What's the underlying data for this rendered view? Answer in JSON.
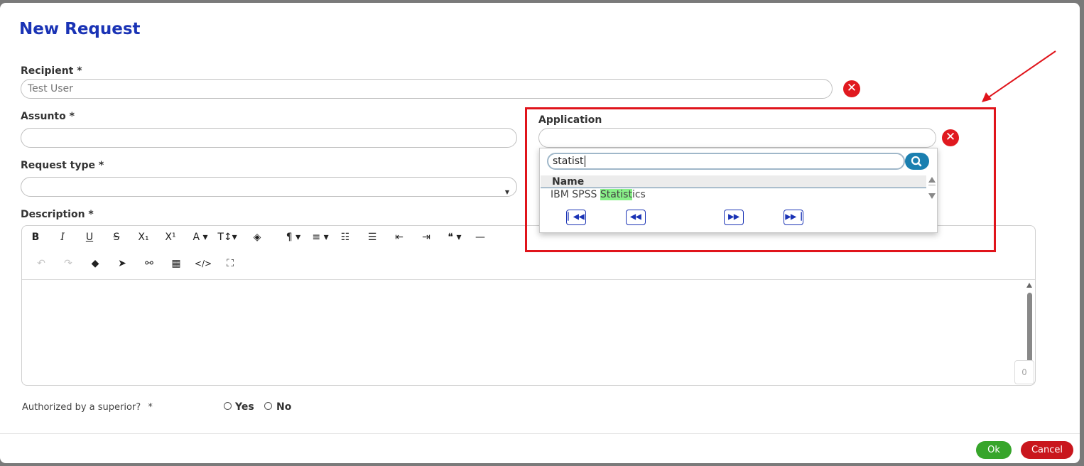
{
  "dialog": {
    "title": "New Request"
  },
  "recipient": {
    "label": "Recipient *",
    "value": "Test User"
  },
  "assunto": {
    "label": "Assunto *",
    "value": ""
  },
  "request_type": {
    "label": "Request type *",
    "value": ""
  },
  "description": {
    "label": "Description *",
    "toolbar_row1": [
      {
        "name": "bold-button",
        "glyph": "B"
      },
      {
        "name": "italic-button",
        "glyph": "I"
      },
      {
        "name": "underline-button",
        "glyph": "U"
      },
      {
        "name": "strikethrough-button",
        "glyph": "S"
      },
      {
        "name": "subscript-button",
        "glyph": "X₁"
      },
      {
        "name": "superscript-button",
        "glyph": "X¹"
      },
      {
        "name": "font-color-dropdown",
        "glyph": "A ▾"
      },
      {
        "name": "font-size-dropdown",
        "glyph": "T↕ ▾"
      },
      {
        "name": "paint-bucket-icon",
        "glyph": "⛽"
      },
      {
        "name": "paragraph-dropdown",
        "glyph": "¶ ▾"
      },
      {
        "name": "align-dropdown",
        "glyph": "≡ ▾"
      },
      {
        "name": "ordered-list-button",
        "glyph": "⒈"
      },
      {
        "name": "unordered-list-button",
        "glyph": "☰"
      },
      {
        "name": "outdent-button",
        "glyph": "⇤"
      },
      {
        "name": "indent-button",
        "glyph": "⇥"
      },
      {
        "name": "quote-dropdown",
        "glyph": "❝ ▾"
      },
      {
        "name": "horizontal-rule-button",
        "glyph": "—"
      }
    ],
    "toolbar_row2": [
      {
        "name": "undo-button",
        "glyph": "↶"
      },
      {
        "name": "redo-button",
        "glyph": "↷"
      },
      {
        "name": "eraser-button",
        "glyph": "⌫"
      },
      {
        "name": "select-cursor-button",
        "glyph": "➤"
      },
      {
        "name": "link-button",
        "glyph": "🔗"
      },
      {
        "name": "table-button",
        "glyph": "▦"
      },
      {
        "name": "code-view-button",
        "glyph": "</>"
      },
      {
        "name": "fullscreen-button",
        "glyph": "⛶"
      }
    ],
    "char_count": "0"
  },
  "application": {
    "label": "Application",
    "value": "",
    "dropdown": {
      "search_value": "statist",
      "column_header": "Name",
      "results": [
        {
          "prefix": "IBM SPSS ",
          "match": "Statist",
          "suffix": "ics"
        }
      ],
      "pager": [
        "⏮",
        "⏪",
        "⏩",
        "⏭"
      ]
    }
  },
  "authorized": {
    "label": "Authorized by a superior?",
    "required": "*",
    "options": [
      "Yes",
      "No"
    ]
  },
  "footer": {
    "ok": "Ok",
    "cancel": "Cancel"
  },
  "colors": {
    "title": "#1a33b5",
    "annotation": "#e0141b",
    "ok": "#37a52b",
    "cancel": "#c9161d",
    "match_highlight": "#88f088"
  }
}
